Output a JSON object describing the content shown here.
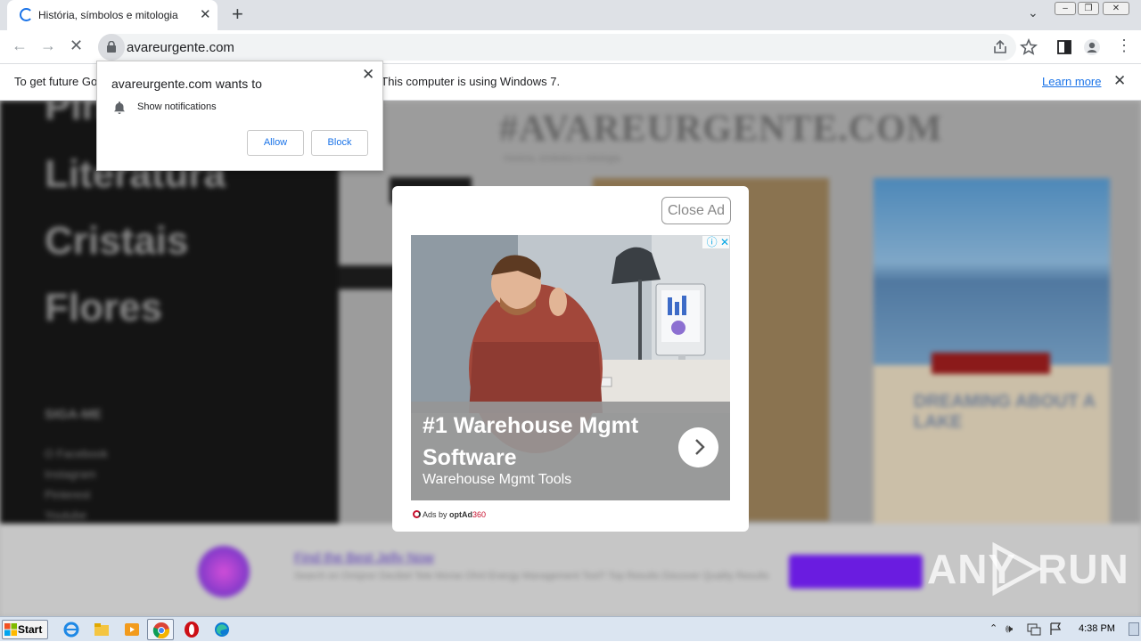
{
  "browser": {
    "tab_title": "História, símbolos e mitologia",
    "url": "avareurgente.com"
  },
  "infobar": {
    "message": "To get future Google Chrome updates, you'll need Windows 10 or later. This computer is using Windows 7.",
    "learn_more": "Learn more"
  },
  "notification_prompt": {
    "title": "avareurgente.com wants to",
    "permission": "Show notifications",
    "allow": "Allow",
    "block": "Block"
  },
  "page": {
    "menu_items": [
      "Pin",
      "Literatura",
      "Cristais",
      "Flores"
    ],
    "follow_heading": "SIGA-ME",
    "social_links": [
      "O Facebook",
      "Instagram",
      "Pinterest",
      "Youtube"
    ],
    "site_title": "#AVAREURGENTE.COM",
    "site_subtitle": "História, símbolos e mitologia",
    "lake_heading": "DREAMING ABOUT A LAKE",
    "bottom_ad_title": "Find the Best Jelly Now",
    "bottom_ad_desc": "Search on Oniqnor Decibel Tele Morse Ohnl Energy Management Tool? Top Results Discover Quality Results"
  },
  "modal_ad": {
    "close_label": "Close Ad",
    "headline": "#1 Warehouse Mgmt Software",
    "subline": "Warehouse Mgmt Tools",
    "ads_by": "Ads by",
    "ads_brand": "optAd",
    "ads_brand_num": "360"
  },
  "watermark": {
    "text_left": "ANY",
    "text_right": "RUN"
  },
  "taskbar": {
    "start": "Start",
    "clock": "4:38 PM"
  },
  "colors": {
    "accent": "#1a73e8",
    "ad_purple": "#6a1ce0",
    "optad_red": "#c8102e"
  }
}
